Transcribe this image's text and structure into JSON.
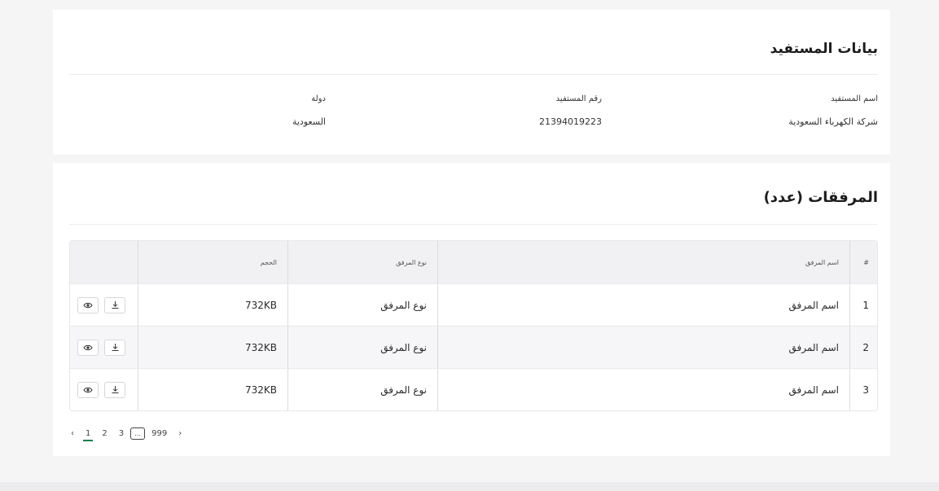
{
  "beneficiary": {
    "title": "بيانات المستفيد",
    "name_label": "اسم المستفيد",
    "name_value": "شركة الكهرباء السعودية",
    "number_label": "رقم المستفيد",
    "number_value": "21394019223",
    "country_label": "دولة",
    "country_value": "السعودية"
  },
  "attachments": {
    "title": "المرفقات (عدد)",
    "columns": {
      "index": "#",
      "name": "اسم المرفق",
      "type": "نوع المرفق",
      "size": "الحجم"
    },
    "rows": [
      {
        "index": "1",
        "name": "اسم المرفق",
        "type": "نوع المرفق",
        "size": "732KB"
      },
      {
        "index": "2",
        "name": "اسم المرفق",
        "type": "نوع المرفق",
        "size": "732KB"
      },
      {
        "index": "3",
        "name": "اسم المرفق",
        "type": "نوع المرفق",
        "size": "732KB"
      }
    ],
    "row_actions": {
      "download_icon": "download-icon",
      "view_icon": "eye-icon"
    }
  },
  "pagination": {
    "prev": "‹",
    "pages": [
      "1",
      "2",
      "3"
    ],
    "active_page": "1",
    "ellipsis": "...",
    "last": "999",
    "next": "›"
  },
  "colors": {
    "page_background": "#f5f5f6",
    "accent_active_page": "#1a7f4b",
    "table_header": "#f1f1f4"
  }
}
